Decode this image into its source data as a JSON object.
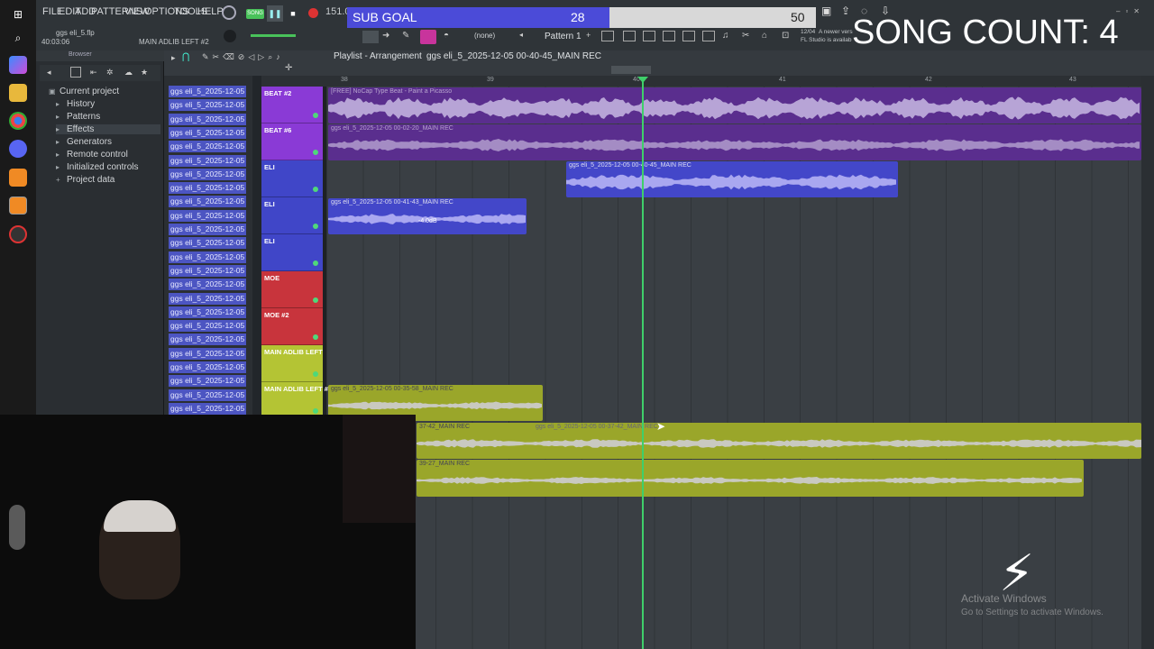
{
  "menu": [
    "FILE",
    "EDIT",
    "ADD",
    "PATTERNS",
    "VIEW",
    "OPTIONS",
    "TOOLS",
    "HELP"
  ],
  "project": {
    "file": "ggs eli_5.flp",
    "time": "40:03:06",
    "hint": "MAIN ADLIB LEFT #2",
    "tempo": "151.0"
  },
  "sub_goal": {
    "label": "SUB GOAL",
    "current": 28,
    "target": 50,
    "progress": 0.56
  },
  "song_count": "SONG COUNT: 4",
  "pattern": {
    "selector": "Pattern 1",
    "snap": "(none)"
  },
  "notify": {
    "date": "12/04",
    "line1": "A newer vers",
    "line2": "FL Studio is availab"
  },
  "browser": {
    "title": "Browser",
    "items": [
      "Current project",
      "History",
      "Patterns",
      "Effects",
      "Generators",
      "Remote control",
      "Initialized controls",
      "Project data"
    ]
  },
  "playlist": {
    "title": "Playlist - Arrangement",
    "breadcrumb": "ggs eli_5_2025-12-05 00-40-45_MAIN REC",
    "clip_list_item": "ggs eli_5_2025-12-05 00...",
    "ruler": [
      "38",
      "39",
      "40",
      "41",
      "42",
      "43"
    ],
    "tracks": [
      {
        "name": "BEAT #2",
        "color": "#8a3ad6"
      },
      {
        "name": "BEAT #6",
        "color": "#8a3ad6"
      },
      {
        "name": "ELI",
        "color": "#4046c8"
      },
      {
        "name": "ELI",
        "color": "#4046c8"
      },
      {
        "name": "ELI",
        "color": "#4046c8"
      },
      {
        "name": "MOE",
        "color": "#c8343c"
      },
      {
        "name": "MOE #2",
        "color": "#c8343c"
      },
      {
        "name": "MAIN ADLIB LEFT",
        "color": "#b4c434"
      },
      {
        "name": "MAIN ADLIB LEFT #2",
        "color": "#b4c434"
      }
    ],
    "clips": [
      {
        "label": "[FREE] NoCap Type Beat - Paint a Picasso"
      },
      {
        "label": "ggs eli_5_2025-12-05 00-02-20_MAIN REC"
      },
      {
        "label": "ggs eli_5_2025-12-05 00-40-45_MAIN REC"
      },
      {
        "label": "ggs eli_5_2025-12-05 00-41-43_MAIN REC",
        "gain": "-4.0dB"
      },
      {
        "label": "ggs eli_5_2025-12-05 00-35-58_MAIN REC"
      },
      {
        "label": "ggs eli_5_2025-12-05 00-37-42_MAIN REC"
      },
      {
        "label": "37-42_MAIN REC"
      },
      {
        "label": "39-27_MAIN REC"
      }
    ]
  },
  "watermark": {
    "line1": "Activate Windows",
    "line2": "Go to Settings to activate Windows."
  },
  "icons": [
    "windows-icon",
    "search-icon",
    "copilot-icon",
    "folder-icon",
    "chrome-icon",
    "discord-icon",
    "fl-studio-icon",
    "obs-icon"
  ]
}
